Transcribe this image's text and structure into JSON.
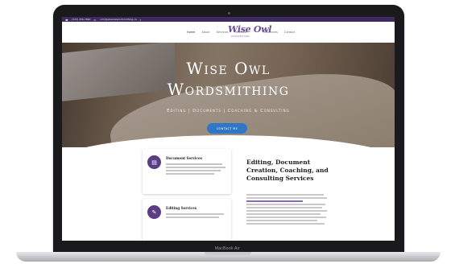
{
  "device": {
    "model_label": "MacBook Air"
  },
  "topbar": {
    "phone": "(123) 456-7890",
    "email": "info@wiseowlwordsmithing.ca"
  },
  "nav": {
    "left_items": [
      "Home",
      "About",
      "Services",
      "Portfolio"
    ],
    "right_items": [
      "Resources",
      "Contact"
    ]
  },
  "logo": {
    "text": "Wise Owl",
    "sub": "WORDSMITHING"
  },
  "hero": {
    "title_line1": "Wise Owl",
    "title_line2": "Wordsmithing",
    "subtitle": "Editing | Documents | Coaching & Consulting",
    "cta": "CONTACT ME"
  },
  "services": [
    {
      "title": "Document Services",
      "icon": "document-icon"
    },
    {
      "title": "Editing Services",
      "icon": "pen-icon"
    }
  ],
  "section": {
    "title": "Editing, Document Creation, Coaching, and Consulting Services"
  },
  "colors": {
    "brand_purple": "#3f2a5e",
    "accent_purple": "#5b3d84",
    "cta_blue": "#2f77c6"
  }
}
